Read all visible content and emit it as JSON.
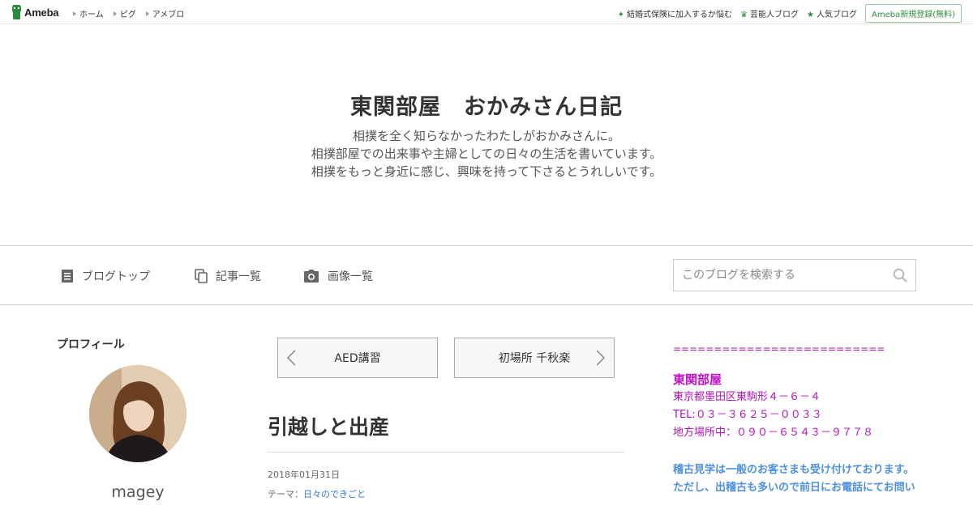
{
  "topbar": {
    "logo_text": "Ameba",
    "nav": [
      "ホーム",
      "ピグ",
      "アメブロ"
    ],
    "links": [
      {
        "icon": "sparkle-icon",
        "label": "結婚式保険に加入するか悩む"
      },
      {
        "icon": "crown-icon",
        "label": "芸能人ブログ"
      },
      {
        "icon": "star-icon",
        "label": "人気ブログ"
      }
    ],
    "register_label": "Ameba新規登録(無料)"
  },
  "header": {
    "title": "東関部屋　おかみさん日記",
    "description": [
      "相撲を全く知らなかったわたしがおかみさんに。",
      "相撲部屋での出来事や主婦としての日々の生活を書いています。",
      "相撲をもっと身近に感じ、興味を持って下さるとうれしいです。"
    ]
  },
  "navbar": {
    "items": [
      {
        "icon": "document-icon",
        "label": "ブログトップ"
      },
      {
        "icon": "copy-icon",
        "label": "記事一覧"
      },
      {
        "icon": "camera-icon",
        "label": "画像一覧"
      }
    ],
    "search_placeholder": "このブログを検索する"
  },
  "profile": {
    "heading": "プロフィール",
    "name": "magey"
  },
  "article": {
    "prev_label": "AED講習",
    "next_label": "初場所 千秋楽",
    "title": "引越しと出産",
    "date": "2018年01月31日",
    "theme_prefix": "テーマ：",
    "theme_link": "日々のできごと"
  },
  "sidebar": {
    "separator": "==========================",
    "org_name": "東関部屋",
    "address": "東京都墨田区東駒形４－６－４",
    "tel": "TEL:０３－３６２５－００３３",
    "regional_office": "地方場所中：０９０－６５４３－９７７８",
    "note_1": "稽古見学は一般のお客さまも受け付けております。",
    "note_2": "ただし、出稽古も多いので前日にお電話にてお問い"
  },
  "colors": {
    "ameba_green": "#2d8c3c",
    "sidebar_purple": "#b113b8",
    "sidebar_blue": "#4d8fe0",
    "link_blue": "#2f7ad1"
  }
}
